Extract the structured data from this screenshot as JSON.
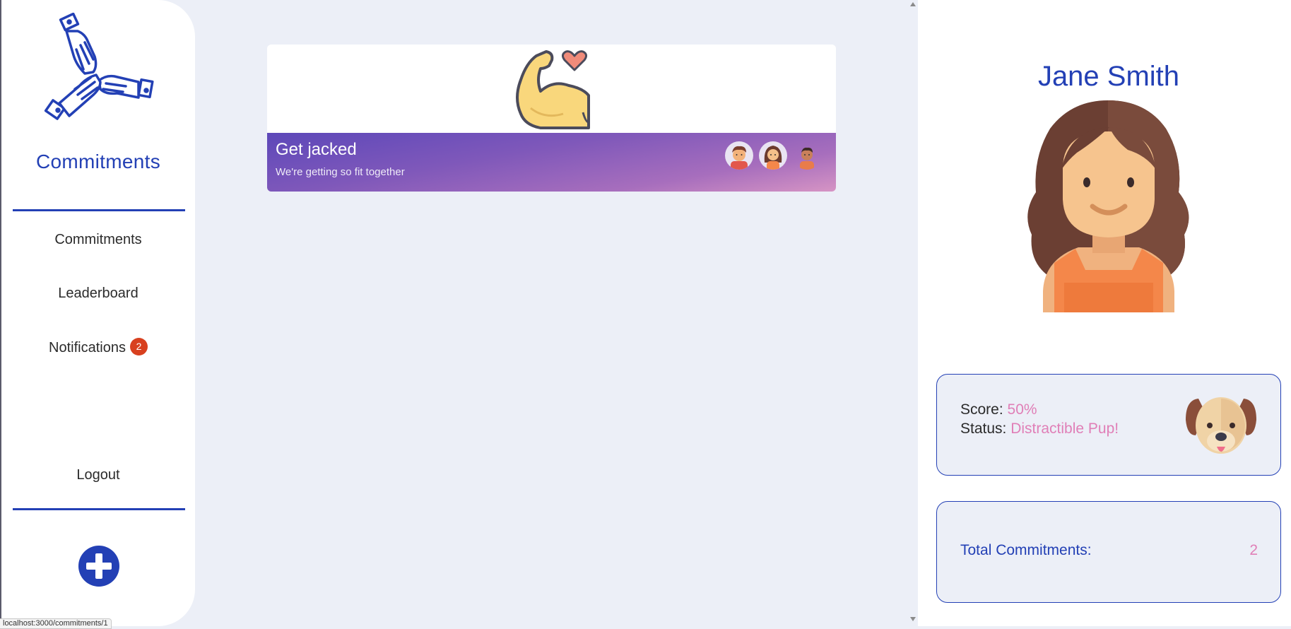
{
  "sidebar": {
    "brand": "Commitments",
    "nav": {
      "commitments": "Commitments",
      "leaderboard": "Leaderboard",
      "notifications": "Notifications",
      "notifications_count": "2",
      "logout": "Logout"
    },
    "add_icon": "plus-circle-icon",
    "logo_icon": "three-hands-icon"
  },
  "status_bar": {
    "url": "localhost:3000/commitments/1"
  },
  "commitment_card": {
    "title": "Get jacked",
    "subtitle": "We're getting so fit together",
    "image_icon": "flexed-arm-heart-icon",
    "members": [
      "man-avatar",
      "woman-avatar",
      "man-avatar-2"
    ]
  },
  "profile": {
    "name": "Jane Smith",
    "avatar_icon": "woman-avatar",
    "score_label": "Score:",
    "score_value": "50%",
    "status_label": "Status:",
    "status_value": "Distractible Pup!",
    "status_icon": "puppy-icon",
    "total_label": "Total Commitments:",
    "total_value": "2"
  },
  "colors": {
    "primary": "#2340b5",
    "accent": "#e07fb7",
    "badge": "#d8401f",
    "page_bg": "#eceff7"
  }
}
